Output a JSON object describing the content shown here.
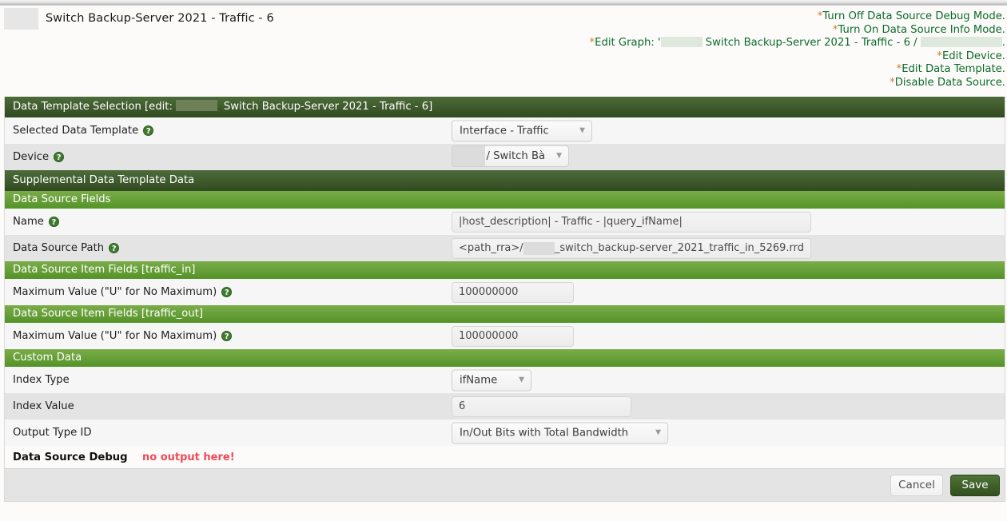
{
  "page": {
    "title": "Switch Backup-Server 2021 - Traffic - 6",
    "redacted_label": ""
  },
  "action_links": [
    {
      "star": "*",
      "text": "Turn Off Data Source Debug Mode.",
      "name": "turn-off-data-source-debug-mode-link"
    },
    {
      "star": "*",
      "text": "Turn On Data Source Info Mode.",
      "name": "turn-on-data-source-info-mode-link"
    },
    {
      "star": "*",
      "text": "Edit Graph: ' Switch Backup-Server 2021 - Traffic - 6 / .",
      "name": "edit-graph-link"
    },
    {
      "star": "*",
      "text": "Edit Device.",
      "name": "edit-device-link"
    },
    {
      "star": "*",
      "text": "Edit Data Template.",
      "name": "edit-data-template-link"
    },
    {
      "star": "*",
      "text": "Disable Data Source.",
      "name": "disable-data-source-link"
    }
  ],
  "edit_graph": {
    "prefix": "*Edit Graph: '",
    "middle": " Switch Backup-Server 2021 - Traffic - 6 / ",
    "suffix": "."
  },
  "sections": {
    "data_template_selection": {
      "title_prefix": "Data Template Selection [edit:",
      "title_suffix": "Switch Backup-Server 2021 - Traffic - 6]"
    },
    "supplemental": "Supplemental Data Template Data",
    "data_source_fields": "Data Source Fields",
    "item_fields_in": "Data Source Item Fields [traffic_in]",
    "item_fields_out": "Data Source Item Fields [traffic_out]",
    "custom_data": "Custom Data"
  },
  "fields": {
    "selected_data_template": {
      "label": "Selected Data Template",
      "value": "Interface - Traffic",
      "help": "?"
    },
    "device": {
      "label": "Device",
      "value": "/ Switch Bà",
      "help": "?"
    },
    "name": {
      "label": "Name",
      "value": "|host_description| - Traffic - |query_ifName|",
      "help": "?"
    },
    "data_source_path": {
      "label": "Data Source Path",
      "prefix": "<path_rra>/",
      "value": "_switch_backup-server_2021_traffic_in_5269.rrd",
      "help": "?"
    },
    "max_value_in": {
      "label": "Maximum Value (\"U\" for No Maximum)",
      "value": "100000000",
      "help": "?"
    },
    "max_value_out": {
      "label": "Maximum Value (\"U\" for No Maximum)",
      "value": "100000000",
      "help": "?"
    },
    "index_type": {
      "label": "Index Type",
      "value": "ifName"
    },
    "index_value": {
      "label": "Index Value",
      "value": "6"
    },
    "output_type_id": {
      "label": "Output Type ID",
      "value": "In/Out Bits with Total Bandwidth"
    },
    "data_source_debug": {
      "label": "Data Source Debug",
      "message": "no output here!"
    }
  },
  "footer": {
    "cancel_label": "Cancel",
    "save_label": "Save"
  },
  "colors": {
    "header_dark": "#3e5a2c",
    "header_green": "#6aa13b",
    "link_green": "#0a6b2a",
    "star_orange": "#cd7b2c",
    "debug_red": "#ef4a57",
    "save_green": "#3d5e28"
  },
  "icons": {
    "help": "?",
    "caret_down": "▼"
  }
}
